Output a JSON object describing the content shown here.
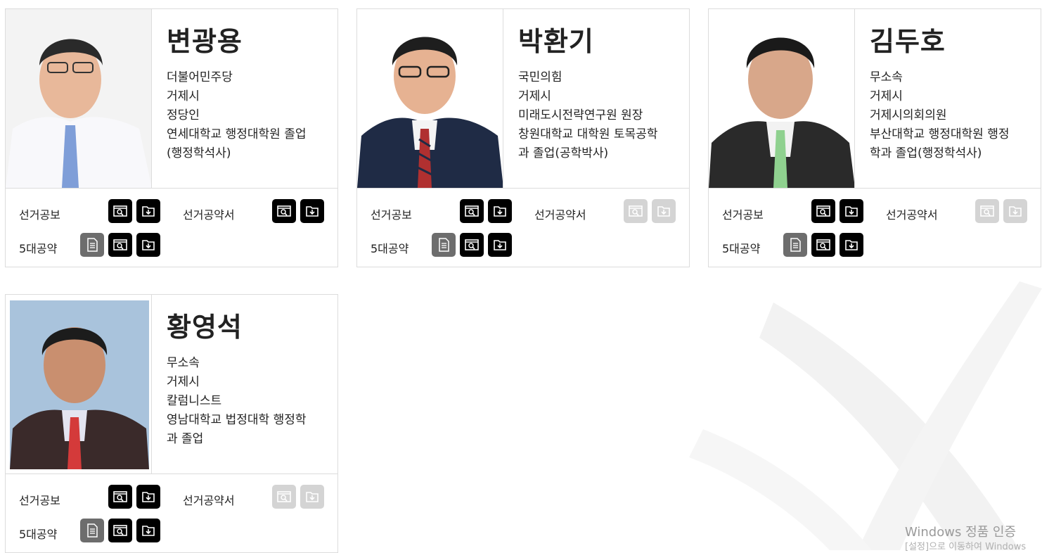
{
  "labels": {
    "bulletin": "선거공보",
    "pledge_book": "선거공약서",
    "five_pledges": "5대공약"
  },
  "candidates": [
    {
      "name": "변광용",
      "details": [
        "더불어민주당",
        "거제시",
        "정당인",
        "연세대학교 행정대학원 졸업",
        "(행정학석사)"
      ],
      "pledge_book_enabled": true
    },
    {
      "name": "박환기",
      "details": [
        "국민의힘",
        "거제시",
        "미래도시전략연구원 원장",
        "창원대학교 대학원 토목공학",
        "과 졸업(공학박사)"
      ],
      "pledge_book_enabled": false
    },
    {
      "name": "김두호",
      "details": [
        "무소속",
        "거제시",
        "거제시의회의원",
        "부산대학교 행정대학원 행정",
        "학과 졸업(행정학석사)"
      ],
      "pledge_book_enabled": false
    },
    {
      "name": "황영석",
      "details": [
        "무소속",
        "거제시",
        "칼럼니스트",
        "영남대학교 법정대학 행정학",
        "과 졸업"
      ],
      "pledge_book_enabled": false
    }
  ],
  "watermark": {
    "line1": "Windows 정품 인증",
    "line2": "[설정]으로 이동하여 Windows"
  },
  "icons": [
    "view-icon",
    "download-icon",
    "document-icon"
  ]
}
